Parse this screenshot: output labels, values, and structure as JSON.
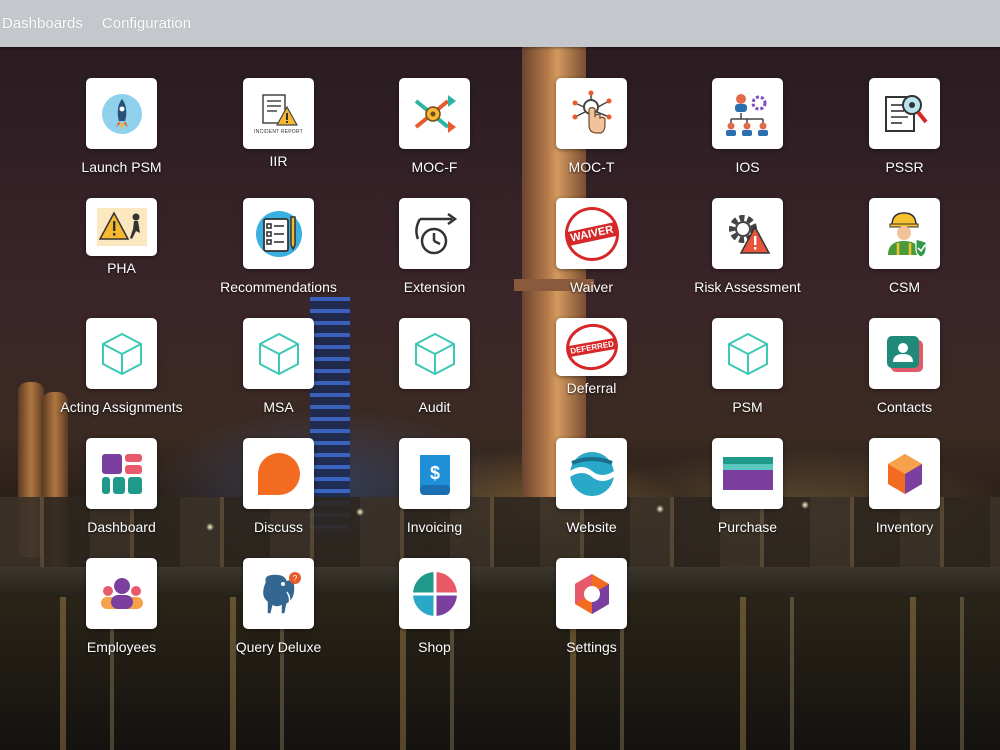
{
  "topbar": {
    "menu_dashboards": "Dashboards",
    "menu_configuration": "Configuration"
  },
  "apps": {
    "launch_psm": "Launch PSM",
    "iir": "IIR",
    "iir_caption": "INCIDENT REPORT",
    "moc_f": "MOC-F",
    "moc_t": "MOC-T",
    "ios": "IOS",
    "pssr": "PSSR",
    "pha": "PHA",
    "recommendations": "Recommendations",
    "extension": "Extension",
    "waiver": "Waiver",
    "waiver_stamp": "WAIVER",
    "risk_assessment": "Risk Assessment",
    "csm": "CSM",
    "acting_assignments": "Acting Assignments",
    "msa": "MSA",
    "audit": "Audit",
    "deferral": "Deferral",
    "deferral_stamp": "DEFERRED",
    "psm": "PSM",
    "contacts": "Contacts",
    "dashboard": "Dashboard",
    "discuss": "Discuss",
    "invoicing": "Invoicing",
    "website": "Website",
    "purchase": "Purchase",
    "inventory": "Inventory",
    "employees": "Employees",
    "query_deluxe": "Query Deluxe",
    "shop": "Shop",
    "settings": "Settings"
  },
  "colors": {
    "topbar": "#c4c8cd",
    "teal_cube": "#3cc8b4",
    "discuss_orange": "#f26b21",
    "inventory_purple": "#7b3fa0",
    "stamp_red": "#d62828"
  }
}
